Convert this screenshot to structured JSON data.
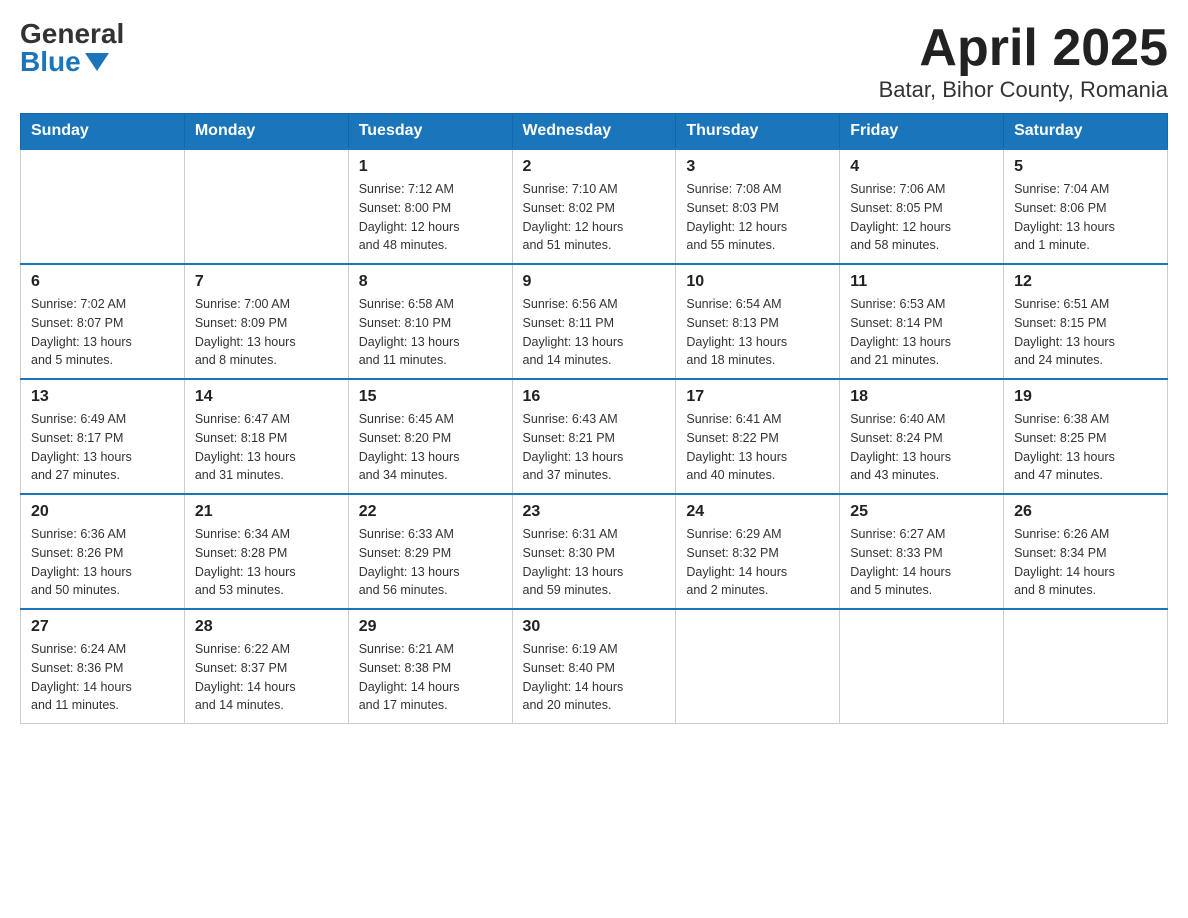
{
  "logo": {
    "general": "General",
    "blue": "Blue"
  },
  "title": "April 2025",
  "subtitle": "Batar, Bihor County, Romania",
  "weekdays": [
    "Sunday",
    "Monday",
    "Tuesday",
    "Wednesday",
    "Thursday",
    "Friday",
    "Saturday"
  ],
  "weeks": [
    [
      {
        "day": "",
        "info": ""
      },
      {
        "day": "",
        "info": ""
      },
      {
        "day": "1",
        "info": "Sunrise: 7:12 AM\nSunset: 8:00 PM\nDaylight: 12 hours\nand 48 minutes."
      },
      {
        "day": "2",
        "info": "Sunrise: 7:10 AM\nSunset: 8:02 PM\nDaylight: 12 hours\nand 51 minutes."
      },
      {
        "day": "3",
        "info": "Sunrise: 7:08 AM\nSunset: 8:03 PM\nDaylight: 12 hours\nand 55 minutes."
      },
      {
        "day": "4",
        "info": "Sunrise: 7:06 AM\nSunset: 8:05 PM\nDaylight: 12 hours\nand 58 minutes."
      },
      {
        "day": "5",
        "info": "Sunrise: 7:04 AM\nSunset: 8:06 PM\nDaylight: 13 hours\nand 1 minute."
      }
    ],
    [
      {
        "day": "6",
        "info": "Sunrise: 7:02 AM\nSunset: 8:07 PM\nDaylight: 13 hours\nand 5 minutes."
      },
      {
        "day": "7",
        "info": "Sunrise: 7:00 AM\nSunset: 8:09 PM\nDaylight: 13 hours\nand 8 minutes."
      },
      {
        "day": "8",
        "info": "Sunrise: 6:58 AM\nSunset: 8:10 PM\nDaylight: 13 hours\nand 11 minutes."
      },
      {
        "day": "9",
        "info": "Sunrise: 6:56 AM\nSunset: 8:11 PM\nDaylight: 13 hours\nand 14 minutes."
      },
      {
        "day": "10",
        "info": "Sunrise: 6:54 AM\nSunset: 8:13 PM\nDaylight: 13 hours\nand 18 minutes."
      },
      {
        "day": "11",
        "info": "Sunrise: 6:53 AM\nSunset: 8:14 PM\nDaylight: 13 hours\nand 21 minutes."
      },
      {
        "day": "12",
        "info": "Sunrise: 6:51 AM\nSunset: 8:15 PM\nDaylight: 13 hours\nand 24 minutes."
      }
    ],
    [
      {
        "day": "13",
        "info": "Sunrise: 6:49 AM\nSunset: 8:17 PM\nDaylight: 13 hours\nand 27 minutes."
      },
      {
        "day": "14",
        "info": "Sunrise: 6:47 AM\nSunset: 8:18 PM\nDaylight: 13 hours\nand 31 minutes."
      },
      {
        "day": "15",
        "info": "Sunrise: 6:45 AM\nSunset: 8:20 PM\nDaylight: 13 hours\nand 34 minutes."
      },
      {
        "day": "16",
        "info": "Sunrise: 6:43 AM\nSunset: 8:21 PM\nDaylight: 13 hours\nand 37 minutes."
      },
      {
        "day": "17",
        "info": "Sunrise: 6:41 AM\nSunset: 8:22 PM\nDaylight: 13 hours\nand 40 minutes."
      },
      {
        "day": "18",
        "info": "Sunrise: 6:40 AM\nSunset: 8:24 PM\nDaylight: 13 hours\nand 43 minutes."
      },
      {
        "day": "19",
        "info": "Sunrise: 6:38 AM\nSunset: 8:25 PM\nDaylight: 13 hours\nand 47 minutes."
      }
    ],
    [
      {
        "day": "20",
        "info": "Sunrise: 6:36 AM\nSunset: 8:26 PM\nDaylight: 13 hours\nand 50 minutes."
      },
      {
        "day": "21",
        "info": "Sunrise: 6:34 AM\nSunset: 8:28 PM\nDaylight: 13 hours\nand 53 minutes."
      },
      {
        "day": "22",
        "info": "Sunrise: 6:33 AM\nSunset: 8:29 PM\nDaylight: 13 hours\nand 56 minutes."
      },
      {
        "day": "23",
        "info": "Sunrise: 6:31 AM\nSunset: 8:30 PM\nDaylight: 13 hours\nand 59 minutes."
      },
      {
        "day": "24",
        "info": "Sunrise: 6:29 AM\nSunset: 8:32 PM\nDaylight: 14 hours\nand 2 minutes."
      },
      {
        "day": "25",
        "info": "Sunrise: 6:27 AM\nSunset: 8:33 PM\nDaylight: 14 hours\nand 5 minutes."
      },
      {
        "day": "26",
        "info": "Sunrise: 6:26 AM\nSunset: 8:34 PM\nDaylight: 14 hours\nand 8 minutes."
      }
    ],
    [
      {
        "day": "27",
        "info": "Sunrise: 6:24 AM\nSunset: 8:36 PM\nDaylight: 14 hours\nand 11 minutes."
      },
      {
        "day": "28",
        "info": "Sunrise: 6:22 AM\nSunset: 8:37 PM\nDaylight: 14 hours\nand 14 minutes."
      },
      {
        "day": "29",
        "info": "Sunrise: 6:21 AM\nSunset: 8:38 PM\nDaylight: 14 hours\nand 17 minutes."
      },
      {
        "day": "30",
        "info": "Sunrise: 6:19 AM\nSunset: 8:40 PM\nDaylight: 14 hours\nand 20 minutes."
      },
      {
        "day": "",
        "info": ""
      },
      {
        "day": "",
        "info": ""
      },
      {
        "day": "",
        "info": ""
      }
    ]
  ]
}
